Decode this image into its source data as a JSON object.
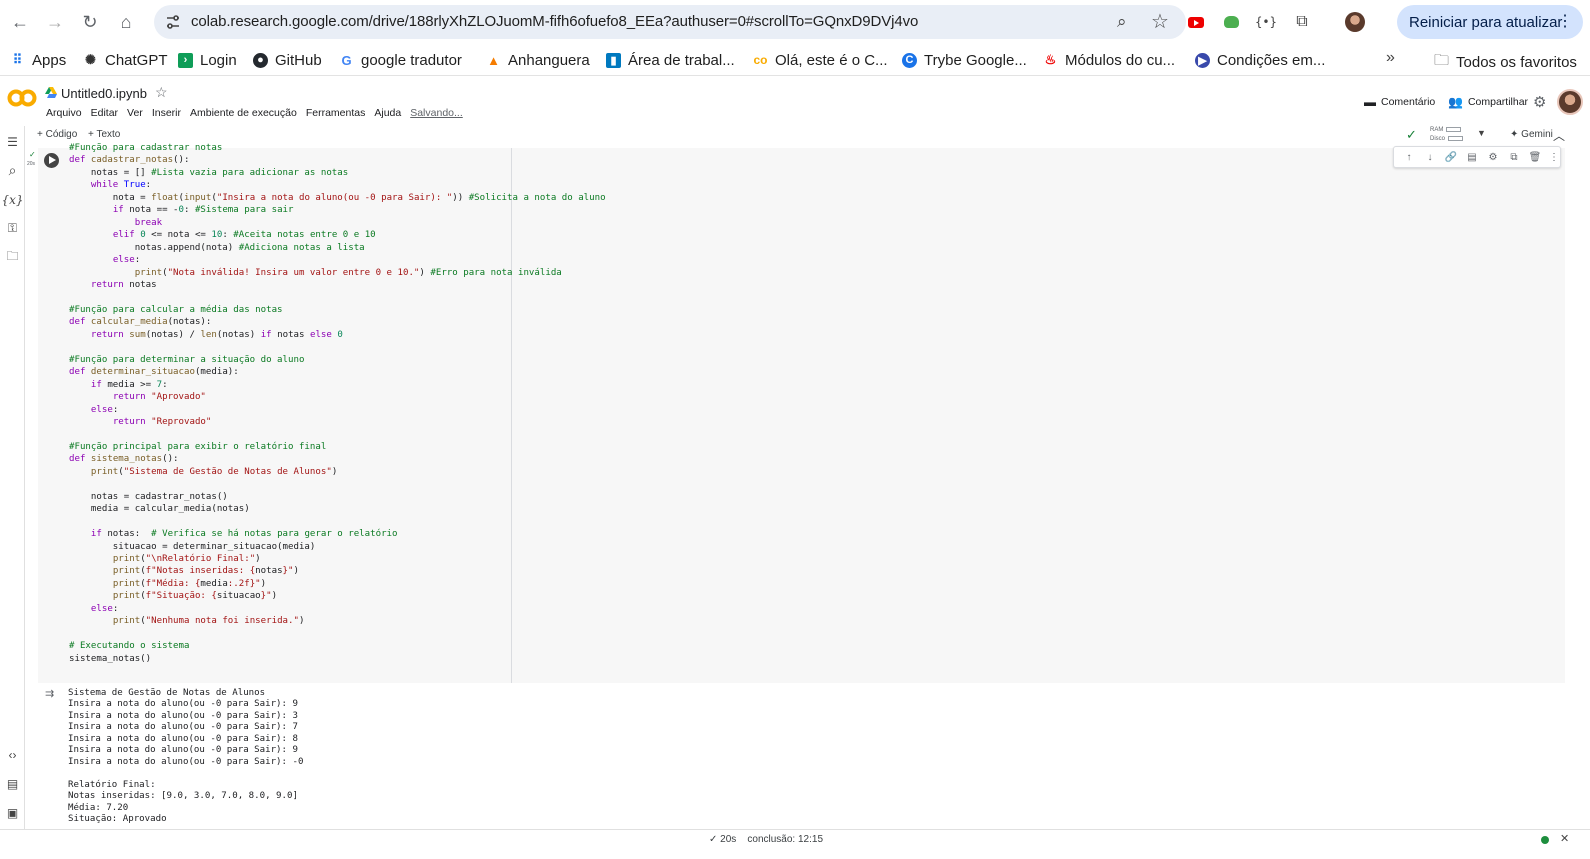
{
  "browser": {
    "url": "colab.research.google.com/drive/188rlyXhZLOJuomM-fifh6ofuefo8_EEa?authuser=0#scrollTo=GQnxD9DVj4vo",
    "reload_label": "Reiniciar para atualizar",
    "extension_icons": [
      "youtube-icon",
      "frog-icon",
      "braces-icon",
      "puzzle-icon",
      "profile-icon"
    ]
  },
  "bookmarks": {
    "items": [
      {
        "label": "Apps",
        "icon": "apps-grid-icon"
      },
      {
        "label": "ChatGPT",
        "icon": "chatgpt-icon"
      },
      {
        "label": "Login",
        "icon": "login-icon"
      },
      {
        "label": "GitHub",
        "icon": "github-icon"
      },
      {
        "label": "google tradutor",
        "icon": "google-icon"
      },
      {
        "label": "Anhanguera",
        "icon": "anhanguera-icon"
      },
      {
        "label": "Área de trabal...",
        "icon": "trello-icon"
      },
      {
        "label": "Olá, este é o C...",
        "icon": "colab-icon"
      },
      {
        "label": "Trybe Google...",
        "icon": "trybe-icon"
      },
      {
        "label": "Módulos do cu...",
        "icon": "santander-icon"
      },
      {
        "label": "Condições em...",
        "icon": "condicoes-icon"
      }
    ],
    "more": "»",
    "all_bookmarks": "Todos os favoritos"
  },
  "colab": {
    "title": "Untitled0.ipynb",
    "menu": [
      "Arquivo",
      "Editar",
      "Ver",
      "Inserir",
      "Ambiente de execução",
      "Ferramentas",
      "Ajuda"
    ],
    "saving": "Salvando...",
    "comment": "Comentário",
    "share": "Compartilhar",
    "add_code": "+ Código",
    "add_text": "+ Texto",
    "ram": "RAM",
    "disk": "Disco",
    "gemini": "Gemini"
  },
  "cell": {
    "exec_time": "20s",
    "output": "Sistema de Gestão de Notas de Alunos\nInsira a nota do aluno(ou -0 para Sair): 9\nInsira a nota do aluno(ou -0 para Sair): 3\nInsira a nota do aluno(ou -0 para Sair): 7\nInsira a nota do aluno(ou -0 para Sair): 8\nInsira a nota do aluno(ou -0 para Sair): 9\nInsira a nota do aluno(ou -0 para Sair): -0\n\nRelatório Final:\nNotas inseridas: [9.0, 3.0, 7.0, 8.0, 9.0]\nMédia: 7.20\nSituação: Aprovado"
  },
  "status": {
    "text": "✓ 20s    conclusão: 12:15"
  }
}
